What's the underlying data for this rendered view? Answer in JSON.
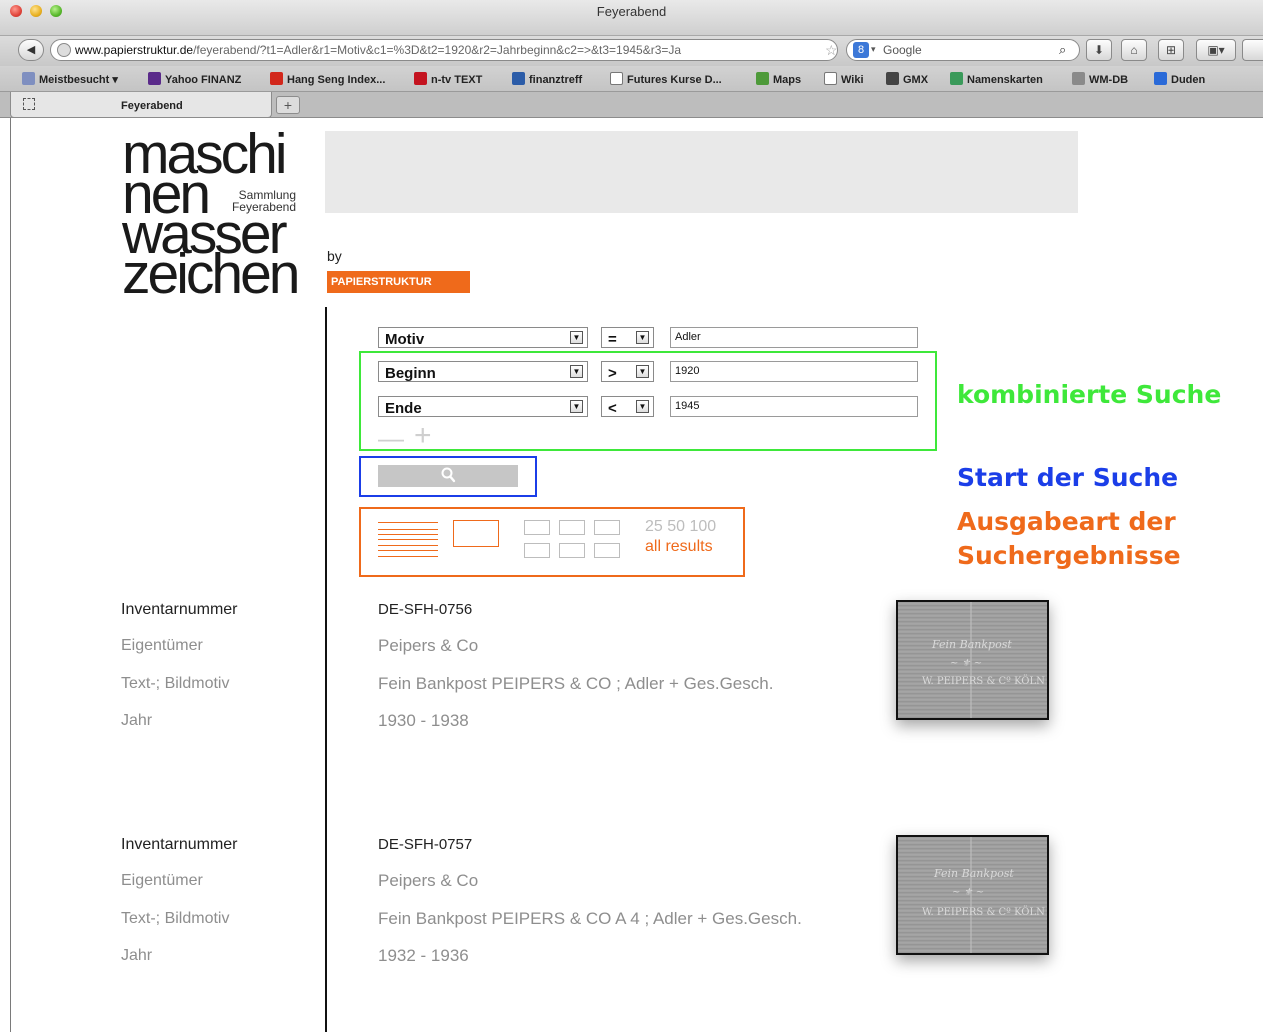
{
  "browser": {
    "window_title": "Feyerabend",
    "url_domain": "www.papierstruktur.de",
    "url_path": "/feyerabend/?t1=Adler&r1=Motiv&c1=%3D&t2=1920&r2=Jahrbeginn&c2=>&t3=1945&r3=Ja",
    "search_engine": "8",
    "search_placeholder": "Google",
    "bookmarks": [
      {
        "label": "Meistbesucht ▾",
        "icon": "folder-icon",
        "color": "#7f8fc0"
      },
      {
        "label": "Yahoo FINANZ",
        "icon": "yahoo-icon",
        "color": "#5a2a8a"
      },
      {
        "label": "Hang Seng Index...",
        "icon": "hangseng-icon",
        "color": "#d2271b"
      },
      {
        "label": "n-tv TEXT",
        "icon": "ntv-icon",
        "color": "#c4131f"
      },
      {
        "label": "finanztreff",
        "icon": "finanztreff-icon",
        "color": "#2b5ca8"
      },
      {
        "label": "Futures Kurse D...",
        "icon": "page-icon",
        "color": "#ffffff"
      },
      {
        "label": "Maps",
        "icon": "maps-icon",
        "color": "#4e9a3a"
      },
      {
        "label": "Wiki",
        "icon": "wiki-icon",
        "color": "#ffffff"
      },
      {
        "label": "GMX",
        "icon": "gmx-icon",
        "color": "#444444"
      },
      {
        "label": "Namenskarten",
        "icon": "namenskarten-icon",
        "color": "#3a9a5a"
      },
      {
        "label": "WM-DB",
        "icon": "wmdb-icon",
        "color": "#8a8a8a"
      },
      {
        "label": "Duden",
        "icon": "duden-icon",
        "color": "#2a6ad8"
      }
    ],
    "tab_label": "Feyerabend"
  },
  "header": {
    "logo_lines": [
      "maschi",
      "nen",
      "wasser",
      "zeichen"
    ],
    "logo_sub_1": "Sammlung",
    "logo_sub_2": "Feyerabend",
    "by": "by",
    "brand": "PAPIERSTRUKTUR"
  },
  "query": {
    "rows": [
      {
        "field": "Motiv",
        "operator": "=",
        "value": "Adler"
      },
      {
        "field": "Beginn",
        "operator": ">",
        "value": "1920"
      },
      {
        "field": "Ende",
        "operator": "<",
        "value": "1945"
      }
    ],
    "remove_symbol": "—",
    "add_symbol": "+"
  },
  "output": {
    "counts": "25 50 100",
    "all_results": "all results"
  },
  "annotations": {
    "combined": "kombinierte Suche",
    "start": "Start der Suche",
    "output_1": "Ausgabeart der",
    "output_2": "Suchergebnisse"
  },
  "labels": {
    "inventory": "Inventarnummer",
    "owner": "Eigentümer",
    "motif": "Text-; Bildmotiv",
    "year": "Jahr"
  },
  "results": [
    {
      "inventory": "DE-SFH-0756",
      "owner": "Peipers & Co",
      "motif": "Fein Bankpost PEIPERS & CO ; Adler + Ges.Gesch.",
      "year": "1930 - 1938"
    },
    {
      "inventory": "DE-SFH-0757",
      "owner": "Peipers & Co",
      "motif": "Fein Bankpost PEIPERS & CO A 4 ; Adler + Ges.Gesch.",
      "year": "1932 - 1936"
    }
  ],
  "colors": {
    "accent": "#ef6a1b",
    "annotation_green": "#3ee83a",
    "annotation_blue": "#1b3ee8"
  }
}
